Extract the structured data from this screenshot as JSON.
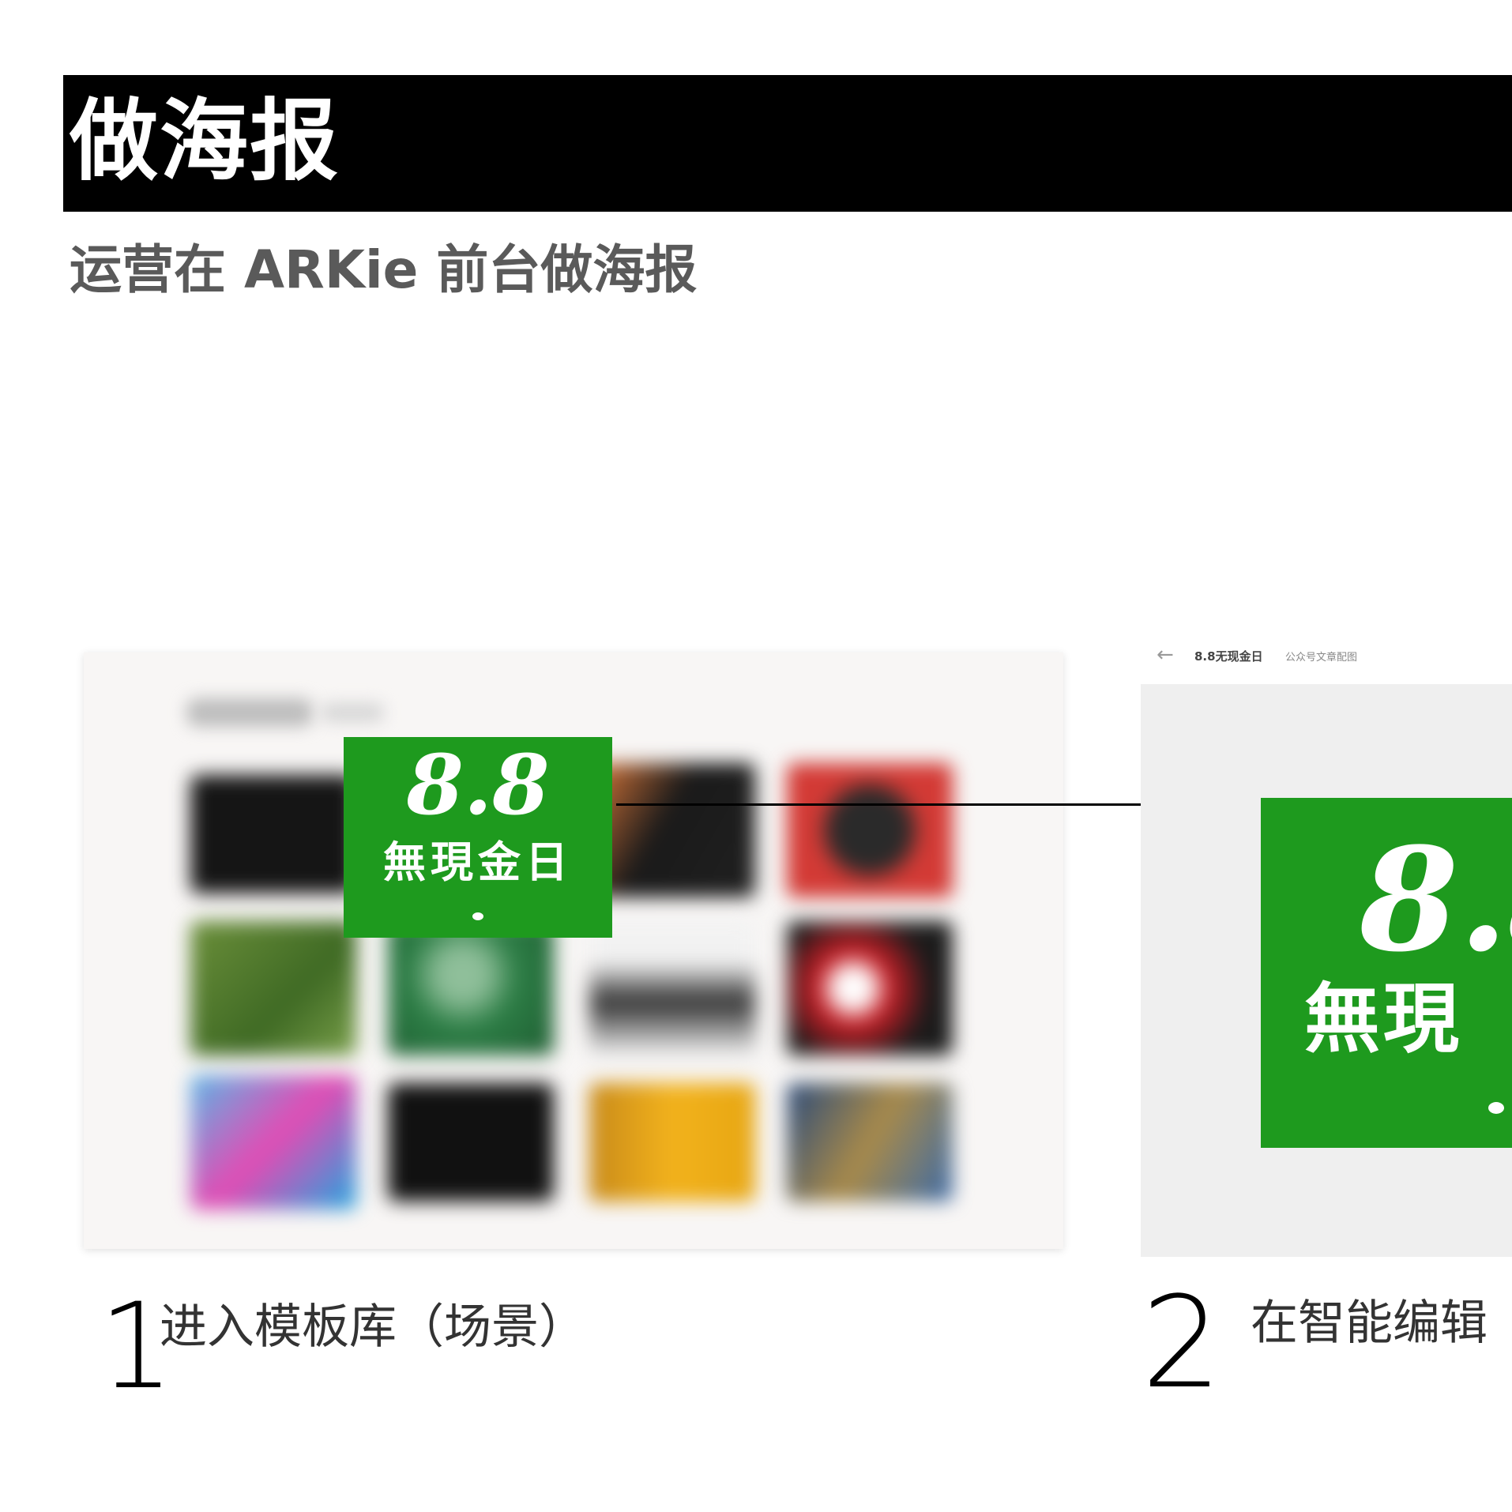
{
  "header": {
    "title": "做海报",
    "subtitle": "运营在 ARKie 前台做海报"
  },
  "step1": {
    "number": "1",
    "label": "进入模板库（场景）"
  },
  "step2": {
    "number": "2",
    "label": "在智能编辑",
    "topbar": {
      "back_icon": "arrow-left-icon",
      "title": "8.8无现金日",
      "category": "公众号文章配图"
    }
  },
  "poster": {
    "big_text": "8.8",
    "line2": "無現金日",
    "line2_cropped": "無現"
  },
  "colors": {
    "poster_green": "#1e9a1e",
    "title_bar": "#000000",
    "subtitle_gray": "#5a5a5a"
  }
}
